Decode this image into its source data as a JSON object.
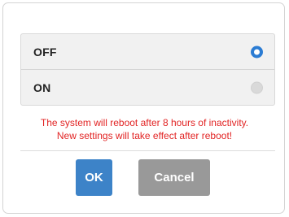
{
  "options": [
    {
      "label": "OFF",
      "selected": true
    },
    {
      "label": "ON",
      "selected": false
    }
  ],
  "message": {
    "line1": "The system will reboot after 8 hours of inactivity.",
    "line2": "New settings will take effect after reboot!"
  },
  "buttons": {
    "ok_label": "OK",
    "cancel_label": "Cancel"
  },
  "colors": {
    "accent": "#3d83c8",
    "radio_selected": "#2b7cd3",
    "warning_text": "#e22424",
    "cancel_button": "#999999",
    "option_background": "#f1f1f1"
  },
  "icons": {
    "selected": "radio-selected-icon",
    "unselected": "radio-unselected-icon"
  }
}
